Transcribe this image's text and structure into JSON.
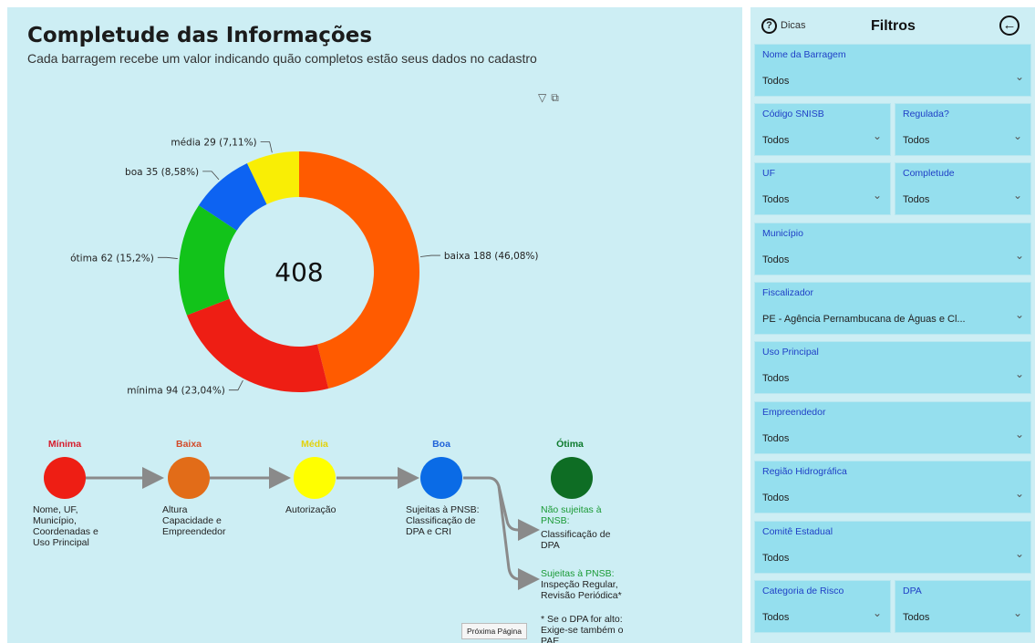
{
  "report": {
    "title": "Completude das Informações",
    "subtitle": "Cada barragem recebe um valor indicando quão completos estão seus dados no cadastro",
    "visual_icons": [
      "filter-icon",
      "focus-mode-icon"
    ]
  },
  "chart_data": {
    "type": "pie",
    "center_value": "408",
    "slices": [
      {
        "name": "baixa",
        "value": 188,
        "label": "baixa 188 (46,08%)",
        "color": "#ff5b00"
      },
      {
        "name": "mínima",
        "value": 94,
        "label": "mínima 94 (23,04%)",
        "color": "#ee1e14"
      },
      {
        "name": "ótima",
        "value": 62,
        "label": "ótima 62 (15,2%)",
        "color": "#12c31a"
      },
      {
        "name": "boa",
        "value": 35,
        "label": "boa 35 (8,58%)",
        "color": "#0d63f2"
      },
      {
        "name": "média",
        "value": 29,
        "label": "média 29 (7,11%)",
        "color": "#f9ee05"
      }
    ]
  },
  "flow": {
    "stages": [
      {
        "title": "Mínima",
        "title_color": "#d61c2c",
        "color": "#ee1e14",
        "desc": "Nome, UF,\nMunicípio,\nCoordenadas e\nUso Principal"
      },
      {
        "title": "Baixa",
        "title_color": "#d24b2a",
        "color": "#e26c18",
        "desc": "Altura\nCapacidade e\nEmpreendedor"
      },
      {
        "title": "Média",
        "title_color": "#e3d20b",
        "color": "#ffff00",
        "desc": "Autorização"
      },
      {
        "title": "Boa",
        "title_color": "#1f62d8",
        "color": "#0a6be6",
        "desc": "Sujeitas à PNSB:\nClassificação de\nDPA e CRI"
      },
      {
        "title": "Ótima",
        "title_color": "#0d7a2c",
        "color": "#0e6d24"
      }
    ],
    "otima_notes": {
      "nao_sujeitas_head": "Não sujeitas à\nPNSB:",
      "nao_sujeitas_body": "Classificação de\nDPA",
      "sujeitas_head": "Sujeitas à PNSB:",
      "sujeitas_body": "Inspeção Regular,\nRevisão Periódica*",
      "footnote": "* Se o DPA for alto:\nExige-se também o\nPAE"
    }
  },
  "tooltip": "Próxima Página",
  "panel": {
    "help_label": "Dicas",
    "title": "Filtros",
    "slicers": [
      {
        "label": "Nome da Barragem",
        "value": "Todos"
      },
      {
        "label": "Código SNISB",
        "value": "Todos"
      },
      {
        "label": "Regulada?",
        "value": "Todos"
      },
      {
        "label": "UF",
        "value": "Todos"
      },
      {
        "label": "Completude",
        "value": "Todos"
      },
      {
        "label": "Município",
        "value": "Todos"
      },
      {
        "label": "Fiscalizador",
        "value": "PE - Agência Pernambucana de Águas e Cl..."
      },
      {
        "label": "Uso Principal",
        "value": "Todos"
      },
      {
        "label": "Empreendedor",
        "value": "Todos"
      },
      {
        "label": "Região Hidrográfica",
        "value": "Todos"
      },
      {
        "label": "Comitê Estadual",
        "value": "Todos"
      },
      {
        "label": "Categoria de Risco",
        "value": "Todos"
      },
      {
        "label": "DPA",
        "value": "Todos"
      }
    ]
  }
}
